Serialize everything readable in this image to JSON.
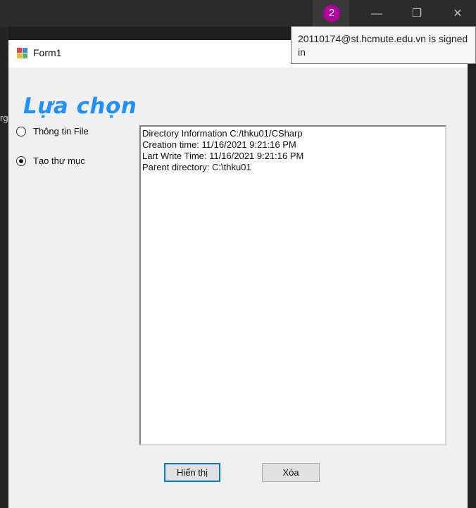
{
  "os": {
    "notification_count": "2",
    "tooltip_text": "20110174@st.hcmute.edu.vn is signed in",
    "left_partial_text": "rg",
    "minimize_glyph": "—",
    "maximize_glyph": "❐",
    "close_glyph": "✕"
  },
  "form": {
    "title": "Form1",
    "heading": "Lựa chọn",
    "options": [
      {
        "label": "Thông tin File",
        "selected": false
      },
      {
        "label": "Tạo thư mục",
        "selected": true
      }
    ],
    "output_lines": [
      "Directory Information C:/thku01/CSharp",
      "Creation time: 11/16/2021 9:21:16 PM",
      "Lart Write Time: 11/16/2021 9:21:16 PM",
      "Parent directory: C:\\thku01"
    ],
    "buttons": {
      "show_label": "Hiển thị",
      "delete_label": "Xóa"
    }
  },
  "colors": {
    "heading": "#1e90ff",
    "badge": "#b4009e",
    "focus_border": "#0078d7"
  }
}
